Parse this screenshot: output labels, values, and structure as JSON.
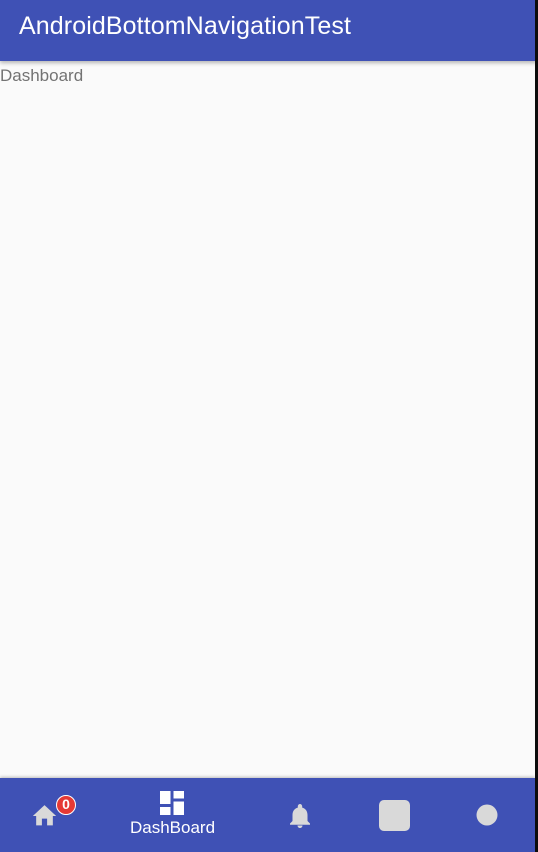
{
  "app_bar": {
    "title": "AndroidBottomNavigationTest"
  },
  "content": {
    "label": "Dashboard"
  },
  "bottom_nav": {
    "items": [
      {
        "id": "home",
        "icon": "home-icon",
        "label": "",
        "badge": "0",
        "active": false
      },
      {
        "id": "dashboard",
        "icon": "dashboard-icon",
        "label": "DashBoard",
        "active": true
      },
      {
        "id": "notifications",
        "icon": "bell-icon",
        "label": "",
        "active": false
      },
      {
        "id": "square",
        "icon": "rounded-square-icon",
        "label": "",
        "active": false
      },
      {
        "id": "circle",
        "icon": "circle-icon",
        "label": "",
        "active": false
      }
    ]
  },
  "colors": {
    "primary": "#3f51b5",
    "background": "#fafafa",
    "on_primary": "#ffffff",
    "inactive_icon": "#d9d9d9",
    "badge": "#e53935",
    "content_text": "#737373"
  }
}
